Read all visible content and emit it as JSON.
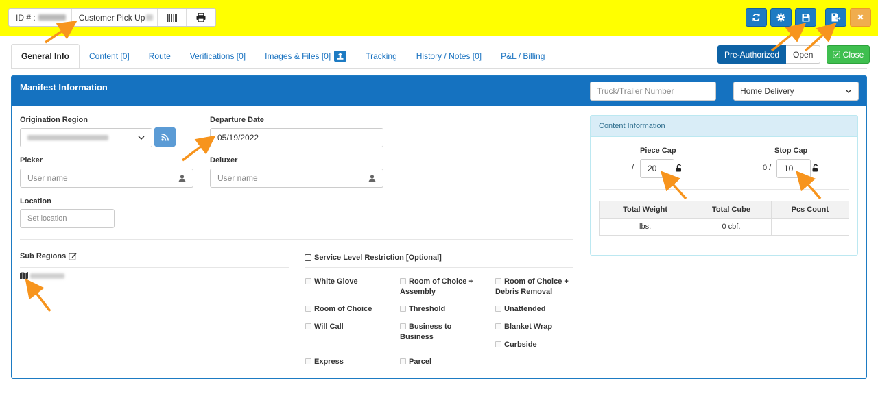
{
  "toolbar": {
    "id_label": "ID # :",
    "ticket_type": "Customer Pick Up",
    "refresh_icon": "refresh-icon",
    "settings_icon": "gear-icon",
    "save_icon": "save-icon",
    "save_exit_icon": "save-exit-icon",
    "close_x": "✖"
  },
  "tabs": [
    {
      "label": "General Info",
      "active": true
    },
    {
      "label": "Content [0]"
    },
    {
      "label": "Route"
    },
    {
      "label": "Verifications [0]"
    },
    {
      "label": "Images & Files [0]"
    },
    {
      "label": "Tracking"
    },
    {
      "label": "History / Notes [0]"
    },
    {
      "label": "P&L / Billing"
    }
  ],
  "status": {
    "pre_authorized": "Pre-Authorized",
    "open": "Open",
    "close": "Close"
  },
  "manifest": {
    "title": "Manifest Information",
    "truck_placeholder": "Truck/Trailer Number",
    "delivery_type": "Home Delivery",
    "origination_label": "Origination Region",
    "departure_label": "Departure Date",
    "departure_value": "05/19/2022",
    "picker_label": "Picker",
    "picker_placeholder": "User name",
    "deluxer_label": "Deluxer",
    "deluxer_placeholder": "User name",
    "location_label": "Location",
    "location_placeholder": "Set location",
    "subregions_label": "Sub Regions",
    "service_level_label": "Service Level Restriction [Optional]",
    "services": [
      "White Glove",
      "Room of Choice + Assembly",
      "Room of Choice + Debris Removal",
      "Room of Choice",
      "Threshold",
      "Unattended",
      "Will Call",
      "Business to Business",
      "Blanket Wrap",
      "Curbside",
      "Express",
      "Parcel"
    ]
  },
  "content_info": {
    "title": "Content Information",
    "piece_cap_label": "Piece Cap",
    "piece_cap_prefix": "/",
    "piece_cap_value": "20",
    "stop_cap_label": "Stop Cap",
    "stop_cap_prefix": "0 /",
    "stop_cap_value": "10",
    "table_headers": [
      "Total Weight",
      "Total Cube",
      "Pcs Count"
    ],
    "table_row": [
      "lbs.",
      "0 cbf.",
      ""
    ]
  },
  "colors": {
    "topbar": "#ffff00",
    "primary": "#1572c0",
    "success": "#3fbf4f",
    "warning": "#f0ad4e",
    "annotation_arrow": "#f7941d"
  }
}
